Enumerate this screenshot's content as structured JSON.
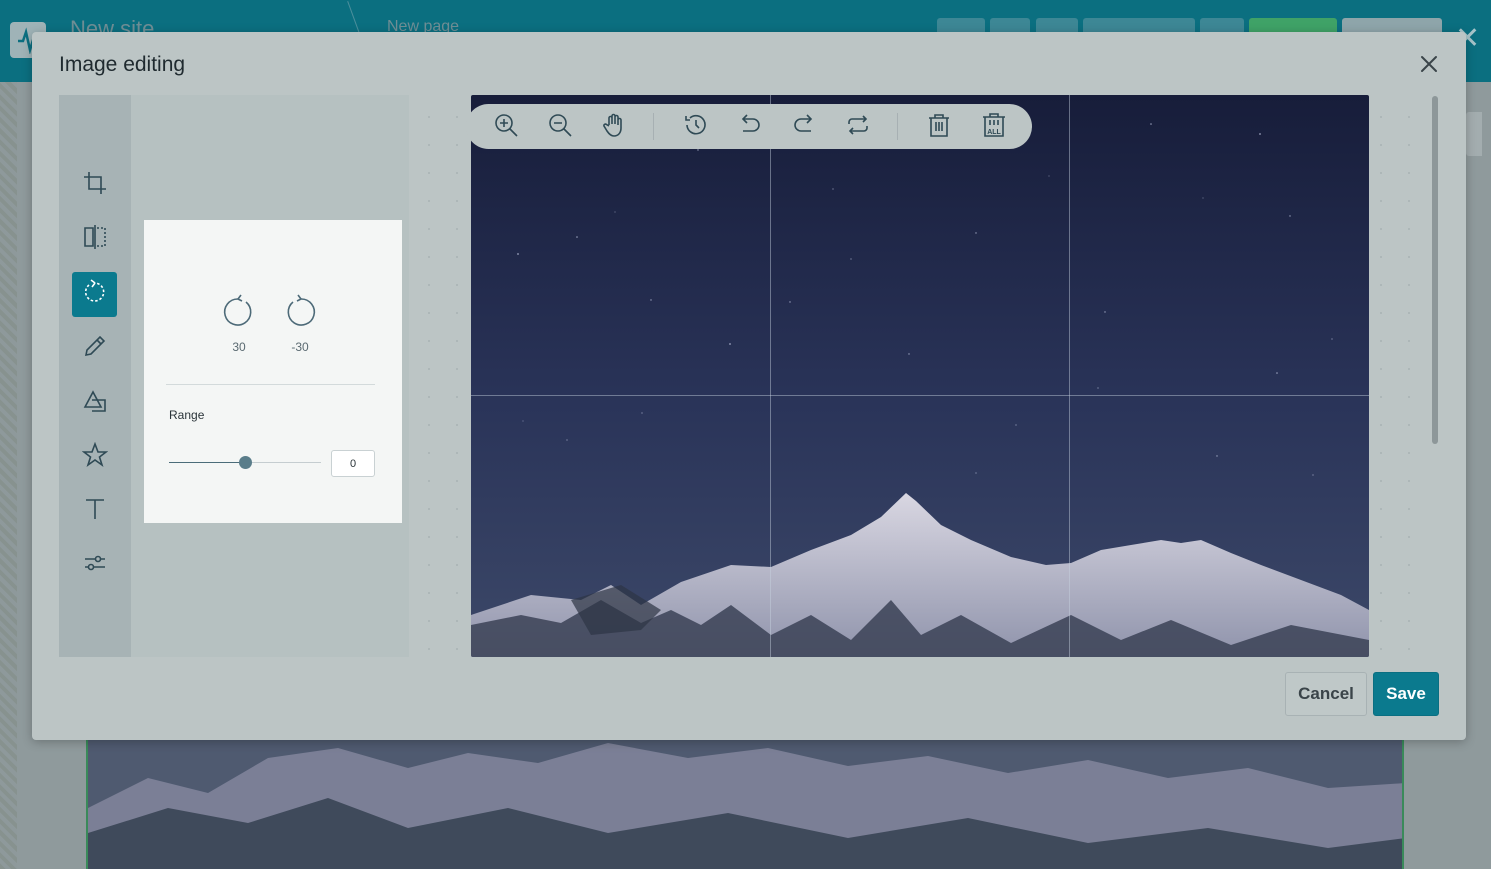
{
  "background": {
    "site_name": "New site",
    "page_name": "New page"
  },
  "modal": {
    "title": "Image editing",
    "close_icon": "close-icon"
  },
  "tools": [
    {
      "name": "crop",
      "icon": "crop-icon",
      "active": false
    },
    {
      "name": "flip",
      "icon": "flip-icon",
      "active": false
    },
    {
      "name": "rotate",
      "icon": "rotate-icon",
      "active": true
    },
    {
      "name": "draw",
      "icon": "pencil-icon",
      "active": false
    },
    {
      "name": "shape",
      "icon": "shapes-icon",
      "active": false
    },
    {
      "name": "icon",
      "icon": "star-icon",
      "active": false
    },
    {
      "name": "text",
      "icon": "text-icon",
      "active": false
    },
    {
      "name": "filter",
      "icon": "sliders-icon",
      "active": false
    }
  ],
  "rotate_panel": {
    "clockwise_label": "30",
    "counter_label": "-30",
    "range_label": "Range",
    "range_value": "0",
    "range_fraction": 0.5
  },
  "image_toolbar": [
    {
      "name": "zoom-in",
      "icon": "zoom-in-icon"
    },
    {
      "name": "zoom-out",
      "icon": "zoom-out-icon"
    },
    {
      "name": "pan",
      "icon": "hand-icon"
    },
    {
      "name": "history",
      "icon": "history-icon"
    },
    {
      "name": "undo",
      "icon": "undo-icon"
    },
    {
      "name": "redo",
      "icon": "redo-icon"
    },
    {
      "name": "reset",
      "icon": "reset-icon"
    },
    {
      "name": "delete",
      "icon": "trash-icon"
    },
    {
      "name": "delete-all",
      "icon": "trash-all-icon",
      "badge": "ALL"
    }
  ],
  "footer": {
    "cancel_label": "Cancel",
    "save_label": "Save"
  },
  "colors": {
    "accent": "#0b7a8e",
    "sky_top": "#171d3a",
    "sky_bottom": "#3c4868",
    "snow": "#c9c9d6"
  }
}
